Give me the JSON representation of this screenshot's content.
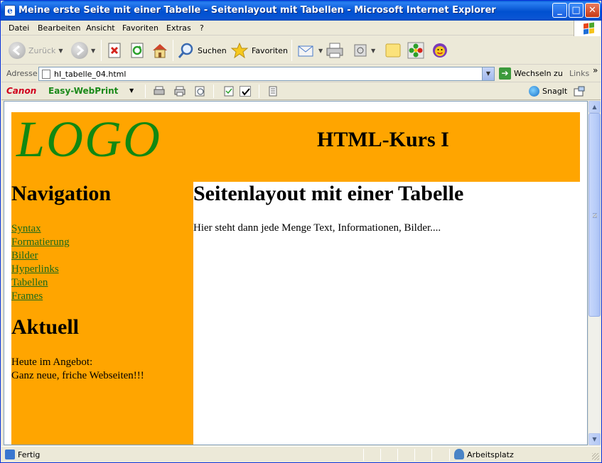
{
  "window": {
    "title": "Meine erste Seite mit einer Tabelle - Seitenlayout mit Tabellen - Microsoft Internet Explorer",
    "controls": {
      "minimize": "_",
      "maximize": "□",
      "close": "✕"
    }
  },
  "menu": {
    "items": [
      "Datei",
      "Bearbeiten",
      "Ansicht",
      "Favoriten",
      "Extras",
      "?"
    ]
  },
  "toolbar": {
    "back": "Zurück",
    "search": "Suchen",
    "favorites": "Favoriten"
  },
  "address": {
    "label": "Adresse",
    "value": "hI_tabelle_04.html",
    "go": "Wechseln zu",
    "links": "Links",
    "more": "»"
  },
  "canon": {
    "brand": "Canon",
    "product": "Easy-WebPrint",
    "snagit": "SnagIt"
  },
  "page": {
    "logo": "LOGO",
    "site_title": "HTML-Kurs I",
    "nav_heading": "Navigation",
    "nav_links": [
      "Syntax",
      "Formatierung",
      "Bilder",
      "Hyperlinks",
      "Tabellen",
      "Frames"
    ],
    "aktuell_heading": "Aktuell",
    "aktuell_line1": "Heute im Angebot:",
    "aktuell_line2": "Ganz neue, friche Webseiten!!!",
    "main_heading": "Seitenlayout mit einer Tabelle",
    "main_text": "Hier steht dann jede Menge Text, Informationen, Bilder...."
  },
  "status": {
    "text": "Fertig",
    "zone": "Arbeitsplatz"
  },
  "colors": {
    "page_orange": "#ffa500",
    "logo_green": "#118811",
    "link_green": "#1a6a1a"
  }
}
